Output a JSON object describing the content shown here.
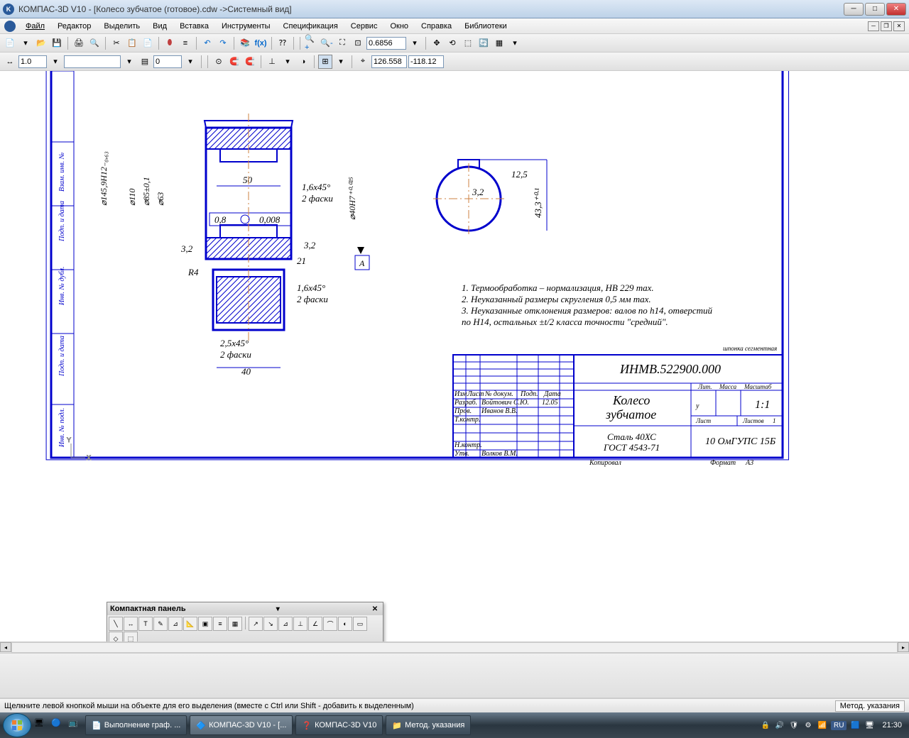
{
  "titlebar": {
    "app": "КОМПАС-3D V10 - [Колесо зубчатое (готовое).cdw ->Системный вид]"
  },
  "menu": {
    "file": "Файл",
    "edit": "Редактор",
    "select": "Выделить",
    "view": "Вид",
    "insert": "Вставка",
    "tools": "Инструменты",
    "spec": "Спецификация",
    "service": "Сервис",
    "window": "Окно",
    "help": "Справка",
    "libraries": "Библиотеки"
  },
  "toolbar1": {
    "zoom_value": "0.6856"
  },
  "toolbar2": {
    "select1": "1.0",
    "select2": "",
    "select3": "0",
    "coord_x": "126.558",
    "coord_y": "-118.12"
  },
  "compact_panel": {
    "title": "Компактная панель"
  },
  "status": {
    "hint": "Щелкните левой кнопкой мыши на объекте для его выделения (вместе с Ctrl или Shift - добавить к выделенным)",
    "box": "Метод. указания"
  },
  "taskbar": {
    "item1": "Выполнение граф. ...",
    "item2": "КОМПАС-3D V10 - [...",
    "item3": "КОМПАС-3D V10",
    "item4": "Метод. указания",
    "lang": "RU",
    "time": "21:30"
  },
  "drawing": {
    "dim_50": "50",
    "dim_16x45_1": "1,6x45°",
    "dim_2chamfer_1": "2 фаски",
    "dim_08": "0,8",
    "dim_0008": "0,008",
    "dim_32_1": "3,2",
    "dim_R4": "R4",
    "dim_21": "21",
    "dim_32_2": "3,2",
    "dim_16x45_2": "1,6x45°",
    "dim_2chamfer_2": "2 фаски",
    "dim_25x45": "2,5x45°",
    "dim_2chamfer_3": "2 фаски",
    "dim_40": "40",
    "dim_d145": "⌀145,9H12₋₀,₆₃",
    "dim_d85": "⌀85±0,1",
    "dim_d63": "⌀63",
    "dim_d110": "⌀110",
    "dim_d40H7": "⌀40H7⁺⁰·⁰²⁵",
    "letter_A": "А",
    "dim_12_5": "12,5",
    "dim_32_3": "3,2",
    "dim_43_3": "43,3⁺⁰·¹",
    "note1": "1. Термообработка – нормализация, HB 229 max.",
    "note2": "2. Неуказанный размеры скругления 0,5 мм max.",
    "note3": "3. Неуказанные отклонения размеров: валов по h14, отверстий",
    "note3b": "   по H14, остальных ±t/2 класса точности \"средний\".",
    "stamp_label": "шпонка сегментная",
    "stamp_code": "ИНМВ.522900.000",
    "stamp_name1": "Колесо",
    "stamp_name2": "зубчатое",
    "stamp_material": "Сталь 40ХС",
    "stamp_gost": "ГОСТ 4543-71",
    "stamp_izm": "Изм",
    "stamp_list": "Лист",
    "stamp_ndoc": "№ докум.",
    "stamp_podp": "Подп.",
    "stamp_data": "Дата",
    "stamp_razrab": "Разраб.",
    "stamp_razrab_name": "Войтович С.Ю.",
    "stamp_razrab_date": "12.05",
    "stamp_prov": "Пров.",
    "stamp_prov_name": "Иванов В.В.",
    "stamp_tkontr": "Т.контр.",
    "stamp_nkontr": "Н.контр.",
    "stamp_utv": "Утв.",
    "stamp_utv_name": "Волков В.М.",
    "stamp_lit": "Лит.",
    "stamp_massa": "Масса",
    "stamp_scale_label": "Масштаб",
    "stamp_scale": "1:1",
    "stamp_u": "у",
    "stamp_list2": "Лист",
    "stamp_listov": "Листов",
    "stamp_listov_n": "1",
    "stamp_org": "10 ОмГУПС 15Б",
    "stamp_kopiroval": "Копировал",
    "stamp_format_label": "Формат",
    "stamp_format": "А3",
    "sidebar_1": "Подп. и дата",
    "sidebar_2": "Инв. № дубл.",
    "sidebar_3": "Взам. инв. №",
    "sidebar_4": "Подп. и дата",
    "sidebar_5": "Инв. № подл."
  }
}
